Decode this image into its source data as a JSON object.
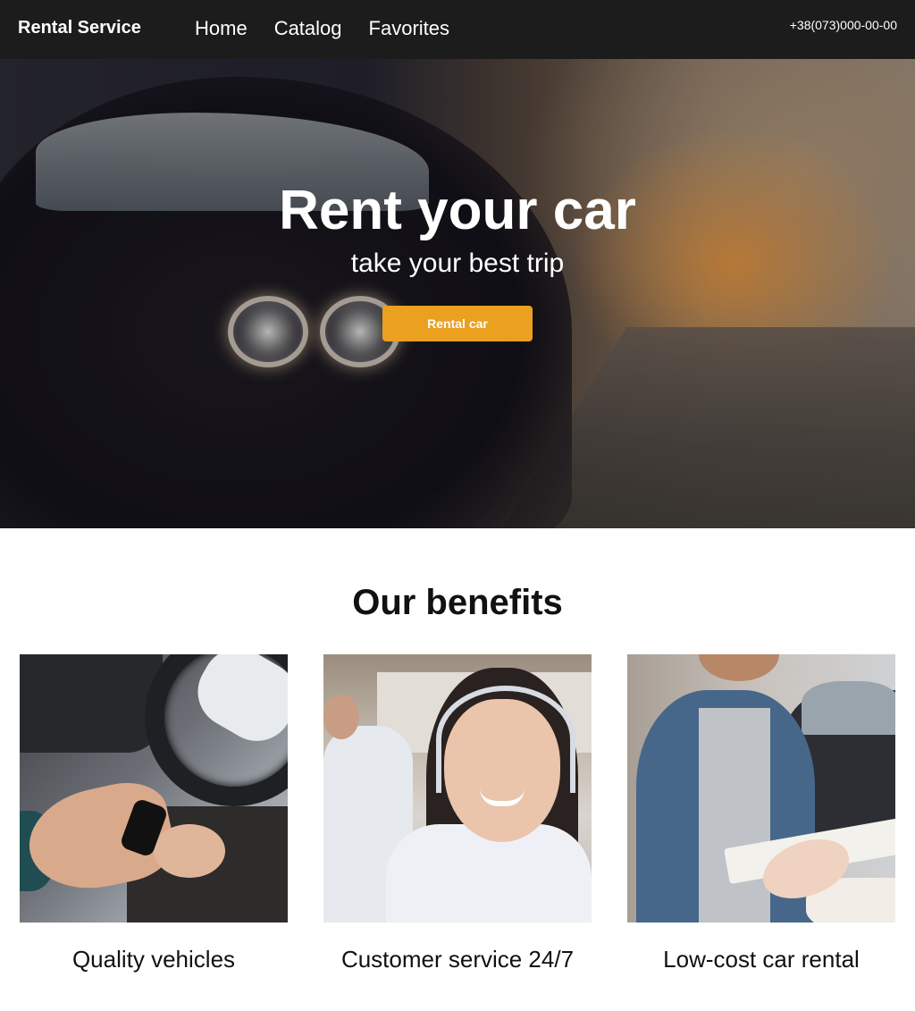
{
  "header": {
    "logo": "Rental Service",
    "nav": [
      {
        "label": "Home"
      },
      {
        "label": "Catalog"
      },
      {
        "label": "Favorites"
      }
    ],
    "phone": "+38(073)000-00-00"
  },
  "hero": {
    "title": "Rent your car",
    "subtitle": "take your best trip",
    "button_label": "Rental car",
    "button_color": "#eba020"
  },
  "benefits": {
    "title": "Our benefits",
    "items": [
      {
        "caption": "Quality vehicles"
      },
      {
        "caption": "Customer service 24/7"
      },
      {
        "caption": "Low-cost car rental"
      }
    ]
  }
}
